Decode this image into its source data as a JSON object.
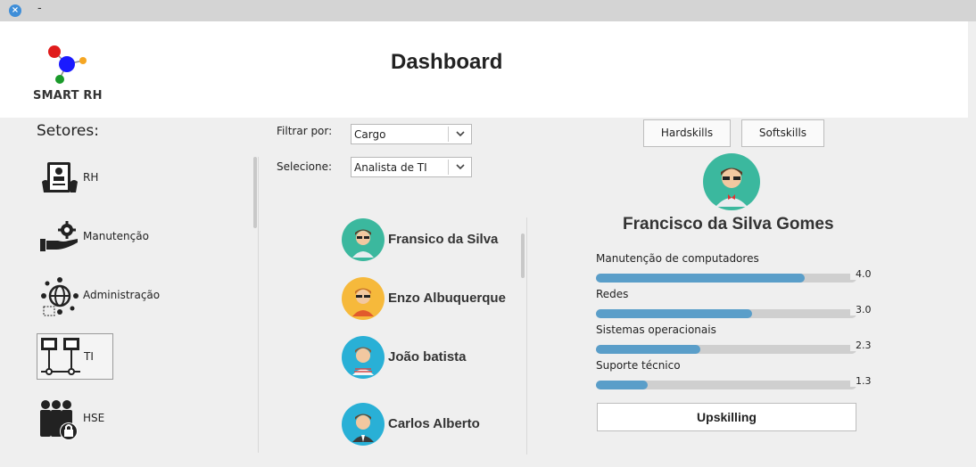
{
  "window": {
    "close_glyph": "×",
    "minimize_glyph": "-"
  },
  "header": {
    "logo_text": "SMART RH",
    "title": "Dashboard"
  },
  "sidebar": {
    "title": "Setores:",
    "items": [
      {
        "label": "RH",
        "icon": "id-badge-icon",
        "selected": false
      },
      {
        "label": "Manutenção",
        "icon": "hand-gear-icon",
        "selected": false
      },
      {
        "label": "Administração",
        "icon": "globe-network-icon",
        "selected": false
      },
      {
        "label": "TI",
        "icon": "computer-network-icon",
        "selected": true
      },
      {
        "label": "HSE",
        "icon": "people-lock-icon",
        "selected": false
      }
    ]
  },
  "filters": {
    "filter_label": "Filtrar por:",
    "filter_value": "Cargo",
    "select_label": "Selecione:",
    "select_value": "Analista de TI"
  },
  "employees": [
    {
      "name": "Fransico da Silva",
      "avatar_bg": "#3bb89e"
    },
    {
      "name": "Enzo Albuquerque",
      "avatar_bg": "#f6b93b"
    },
    {
      "name": "João batista",
      "avatar_bg": "#29b0d6"
    },
    {
      "name": "Carlos Alberto",
      "avatar_bg": "#29b0d6"
    }
  ],
  "profile": {
    "tabs": {
      "hard": "Hardskills",
      "soft": "Softskills"
    },
    "name": "Francisco da Silva Gomes",
    "avatar_bg": "#3bb89e",
    "skills": [
      {
        "label": "Manutenção de computadores",
        "value": "4.0",
        "level": 0.8
      },
      {
        "label": "Redes",
        "value": "3.0",
        "level": 0.6
      },
      {
        "label": "Sistemas operacionais",
        "value": "2.3",
        "level": 0.4
      },
      {
        "label": "Suporte técnico",
        "value": "1.3",
        "level": 0.2
      }
    ],
    "upskilling_label": "Upskilling"
  },
  "colors": {
    "accent": "#5a9ec9",
    "track": "#cfcfcf"
  }
}
